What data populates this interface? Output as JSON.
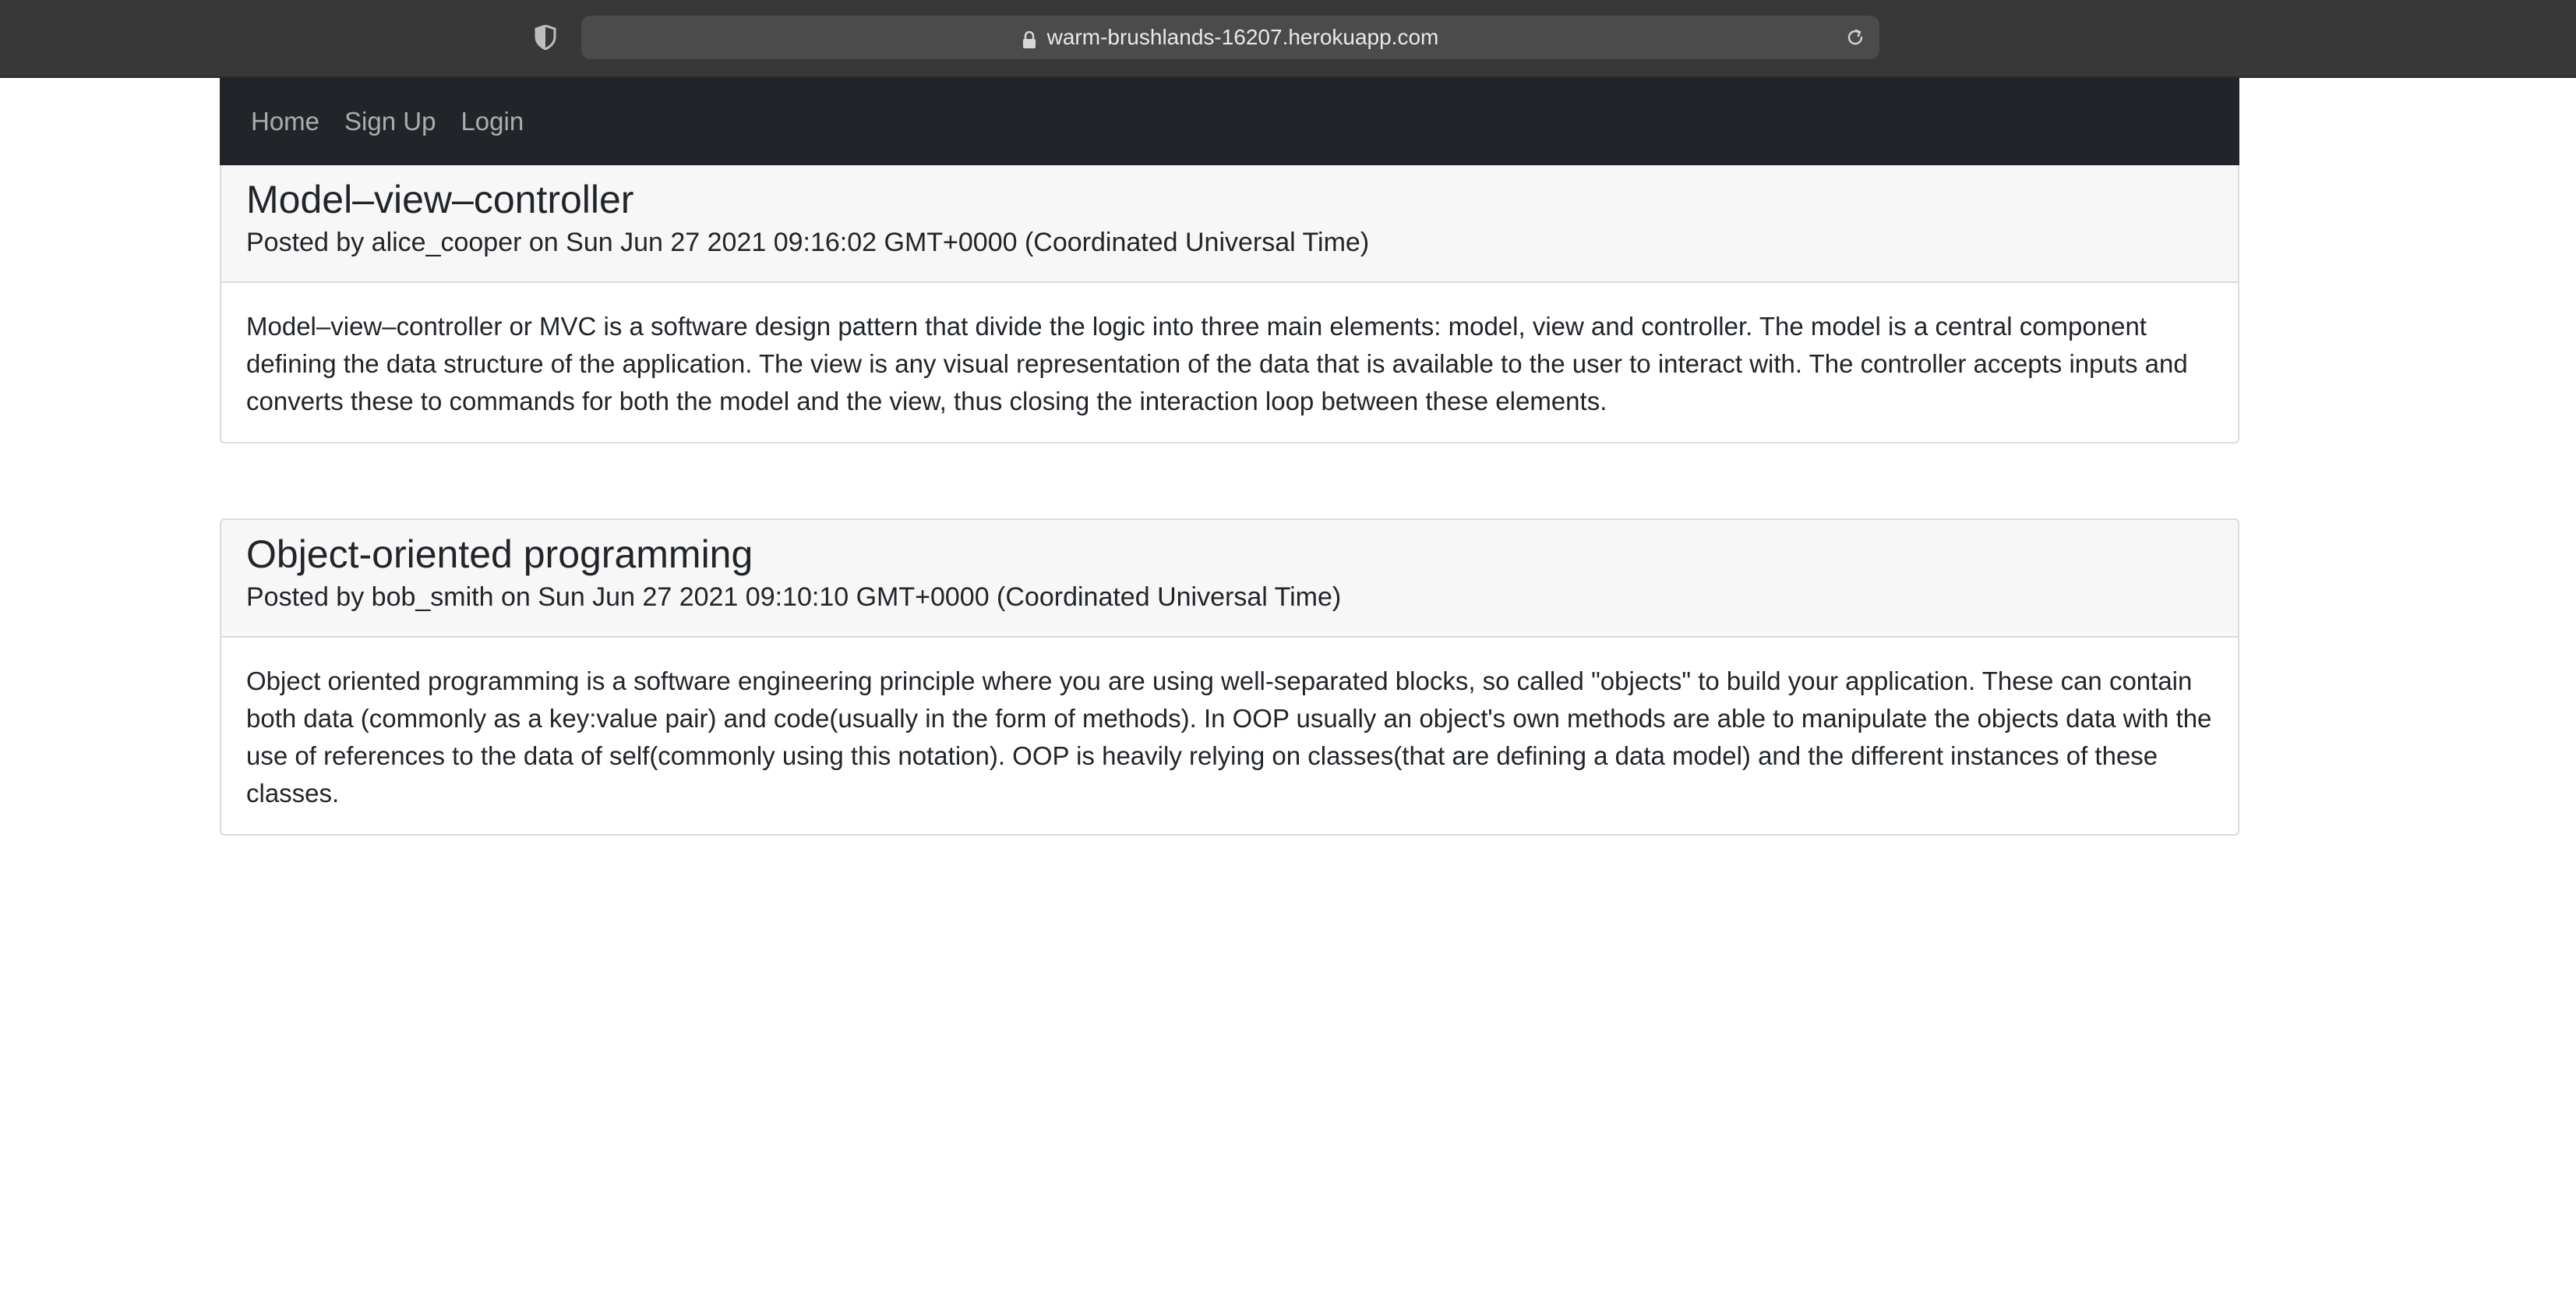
{
  "browser": {
    "url": "warm-brushlands-16207.herokuapp.com",
    "shield_icon": "shield-icon",
    "lock_icon": "lock-icon",
    "reload_icon": "reload-icon"
  },
  "nav": {
    "items": [
      {
        "label": "Home"
      },
      {
        "label": "Sign Up"
      },
      {
        "label": "Login"
      }
    ]
  },
  "posts": [
    {
      "title": "Model–view–controller",
      "meta": "Posted by alice_cooper on Sun Jun 27 2021 09:16:02 GMT+0000 (Coordinated Universal Time)",
      "body": "Model–view–controller or MVC is a software design pattern that divide the logic into three main elements: model, view and controller. The model is a central component defining the data structure of the application. The view is any visual representation of the data that is available to the user to interact with. The controller accepts inputs and converts these to commands for both the model and the view, thus closing the interaction loop between these elements."
    },
    {
      "title": "Object-oriented programming",
      "meta": "Posted by bob_smith on Sun Jun 27 2021 09:10:10 GMT+0000 (Coordinated Universal Time)",
      "body": "Object oriented programming is a software engineering principle where you are using well-separated blocks, so called \"objects\" to build your application. These can contain both data (commonly as a key:value pair) and code(usually in the form of methods). In OOP usually an object's own methods are able to manipulate the objects data with the use of references to the data of self(commonly using this notation). OOP is heavily relying on classes(that are defining a data model) and the different instances of these classes."
    }
  ],
  "colors": {
    "navbar_bg": "#212529",
    "browser_bg": "#383838",
    "card_header_bg": "#f7f7f7"
  }
}
